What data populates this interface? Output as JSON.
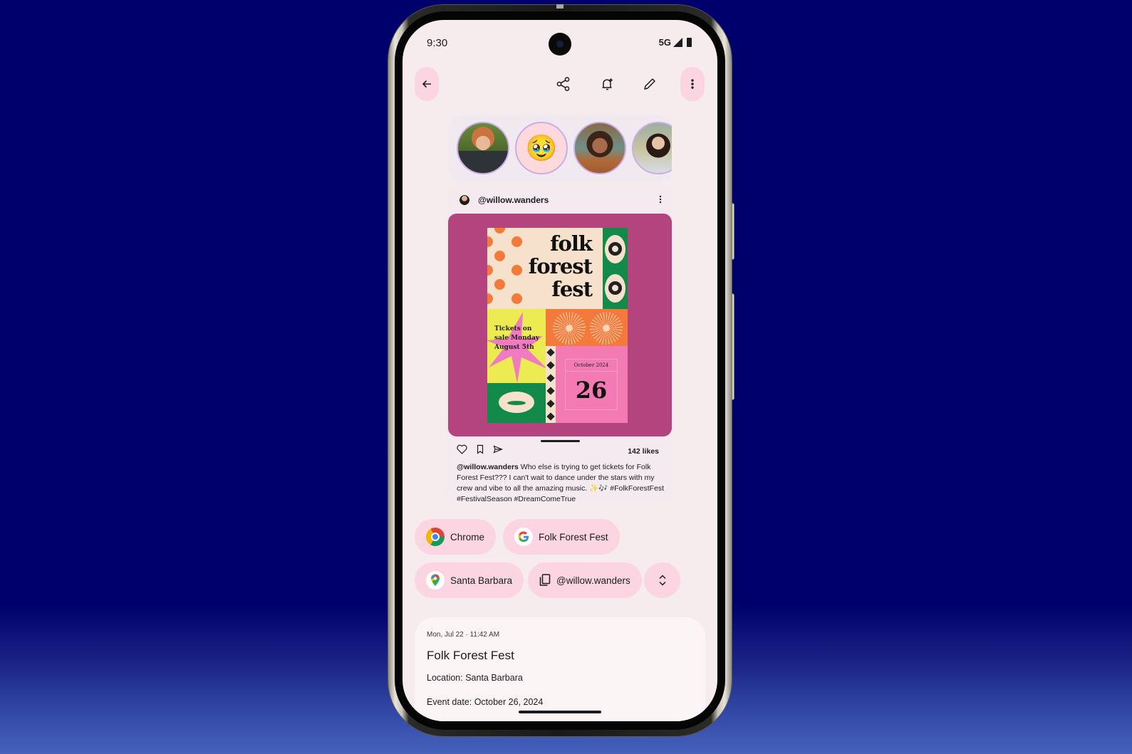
{
  "status_bar": {
    "time": "9:30",
    "network": "5G"
  },
  "toolbar": {
    "back_icon": "arrow-back-icon",
    "share_icon": "share-icon",
    "reminder_icon": "bell-plus-icon",
    "edit_icon": "pencil-icon",
    "more_icon": "more-vert-icon"
  },
  "avatars": [
    {
      "type": "photo",
      "label": "contact-1"
    },
    {
      "type": "emoji",
      "emoji": "🥹"
    },
    {
      "type": "photo",
      "label": "contact-3"
    },
    {
      "type": "photo",
      "label": "contact-4"
    }
  ],
  "post": {
    "username": "@willow.wanders",
    "poster": {
      "title_lines": [
        "folk",
        "forest",
        "fest"
      ],
      "tickets_text": [
        "Tickets on",
        "sale Monday",
        "August 5th"
      ],
      "calendar_month": "October 2024",
      "calendar_day": "26"
    },
    "likes": "142 likes",
    "caption_user": "@willow.wanders",
    "caption_text": " Who else is trying to get tickets for Folk Forest Fest??? I can't wait to dance under the stars with my crew and vibe to all the amazing music. ✨🎶 #FolkForestFest #FestivalSeason #DreamComeTrue"
  },
  "chips": {
    "chrome": "Chrome",
    "google": "Folk Forest Fest",
    "maps": "Santa Barbara",
    "copy": "@willow.wanders"
  },
  "event": {
    "meta": "Mon, Jul 22 · 11:42 AM",
    "title": "Folk Forest Fest",
    "location": "Location: Santa Barbara",
    "date": "Event date: October 26, 2024"
  },
  "colors": {
    "background_top": "#00006c",
    "background_bottom": "#4662bb",
    "screen_bg": "#f6ecee",
    "chip_bg": "#fbd6e2",
    "poster_frame": "#b4447e"
  }
}
